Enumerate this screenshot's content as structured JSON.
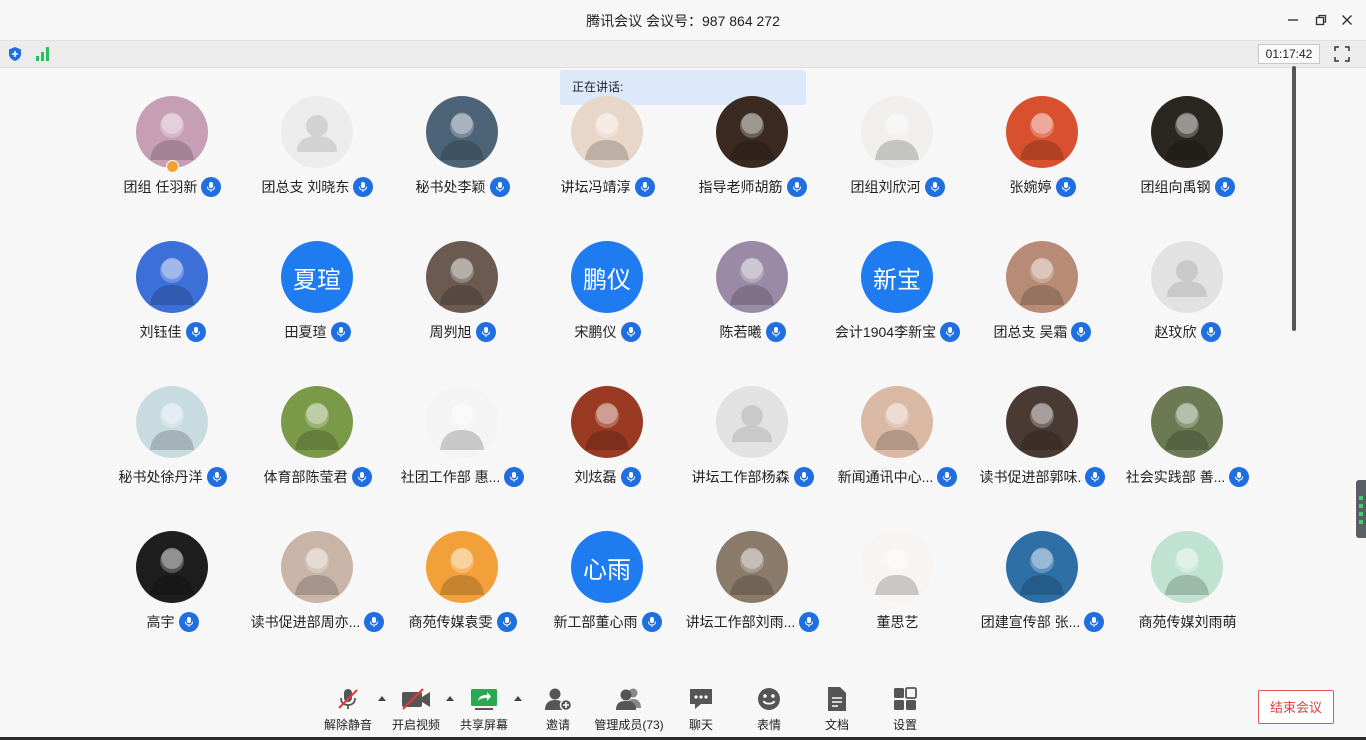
{
  "window": {
    "title": "腾讯会议 会议号：987 864 272",
    "timer": "01:17:42"
  },
  "speaking_label": "正在讲话:",
  "participants": [
    {
      "name": "团组 任羽新",
      "avatar": "photo",
      "color": "#c79fb5",
      "host": true
    },
    {
      "name": "团总支 刘晓东",
      "avatar": "placeholder",
      "color": "#ececec"
    },
    {
      "name": "秘书处李颖",
      "avatar": "photo",
      "color": "#4d6478"
    },
    {
      "name": "讲坛冯靖淳",
      "avatar": "photo",
      "color": "#e8d6c8"
    },
    {
      "name": "指导老师胡筋",
      "avatar": "photo",
      "color": "#3a2a22"
    },
    {
      "name": "团组刘欣河",
      "avatar": "photo",
      "color": "#f0efee"
    },
    {
      "name": "张婉婷",
      "avatar": "photo",
      "color": "#d8502e"
    },
    {
      "name": "团组向禹钢",
      "avatar": "photo",
      "color": "#2a2620"
    },
    {
      "name": "刘钰佳",
      "avatar": "photo",
      "color": "#3c6fd8"
    },
    {
      "name": "田夏瑄",
      "avatar": "initials",
      "initials": "夏瑄",
      "color": "#1f7cf0"
    },
    {
      "name": "周刿旭",
      "avatar": "photo",
      "color": "#6a5a50"
    },
    {
      "name": "宋鹏仪",
      "avatar": "initials",
      "initials": "鹏仪",
      "color": "#1f7cf0"
    },
    {
      "name": "陈若曦",
      "avatar": "photo",
      "color": "#9a8aa6"
    },
    {
      "name": "会计1904李新宝",
      "avatar": "initials",
      "initials": "新宝",
      "color": "#1f7cf0"
    },
    {
      "name": "团总支 吴霜",
      "avatar": "photo",
      "color": "#b78b76"
    },
    {
      "name": "赵玟欣",
      "avatar": "placeholder2",
      "color": "#e2e2e2"
    },
    {
      "name": "秘书处徐丹洋",
      "avatar": "photo",
      "color": "#c8dbe0"
    },
    {
      "name": "体育部陈莹君",
      "avatar": "photo",
      "color": "#7a9a4a"
    },
    {
      "name": "社团工作部 惠...",
      "avatar": "photo",
      "color": "#f4f4f4"
    },
    {
      "name": "刘炫磊",
      "avatar": "photo",
      "color": "#9a3a22"
    },
    {
      "name": "讲坛工作部杨森",
      "avatar": "placeholder2",
      "color": "#e2e2e2"
    },
    {
      "name": "新闻通讯中心...",
      "avatar": "photo",
      "color": "#d9b8a4"
    },
    {
      "name": "读书促进部郭味.",
      "avatar": "photo",
      "color": "#4a3a34"
    },
    {
      "name": "社会实践部 善...",
      "avatar": "photo",
      "color": "#6b7a52"
    },
    {
      "name": "高宇",
      "avatar": "photo",
      "color": "#1e1e1e"
    },
    {
      "name": "读书促进部周亦...",
      "avatar": "photo",
      "color": "#c9b5a8"
    },
    {
      "name": "商苑传媒袁雯",
      "avatar": "photo",
      "color": "#f2a13a"
    },
    {
      "name": "新工部董心雨",
      "avatar": "initials",
      "initials": "心雨",
      "color": "#1f7cf0"
    },
    {
      "name": "讲坛工作部刘雨...",
      "avatar": "photo",
      "color": "#8a7a6a"
    },
    {
      "name": "董思艺",
      "avatar": "photo",
      "color": "#f7f4f2",
      "muted_icon": false
    },
    {
      "name": "团建宣传部 张...",
      "avatar": "photo",
      "color": "#2e6fa6"
    },
    {
      "name": "商苑传媒刘雨萌",
      "avatar": "photo",
      "color": "#bfe3d0",
      "muted_icon": false
    }
  ],
  "toolbar": {
    "unmute": "解除静音",
    "start_video": "开启视频",
    "share_screen": "共享屏幕",
    "invite": "邀请",
    "manage_members": "管理成员(73)",
    "chat": "聊天",
    "reactions": "表情",
    "docs": "文档",
    "settings": "设置"
  },
  "end_meeting": "结束会议",
  "colors": {
    "accent": "#1f7cf0",
    "mic_badge": "#1f6fe0",
    "end_meeting": "#e04040",
    "signal": "#2bbf5b"
  }
}
